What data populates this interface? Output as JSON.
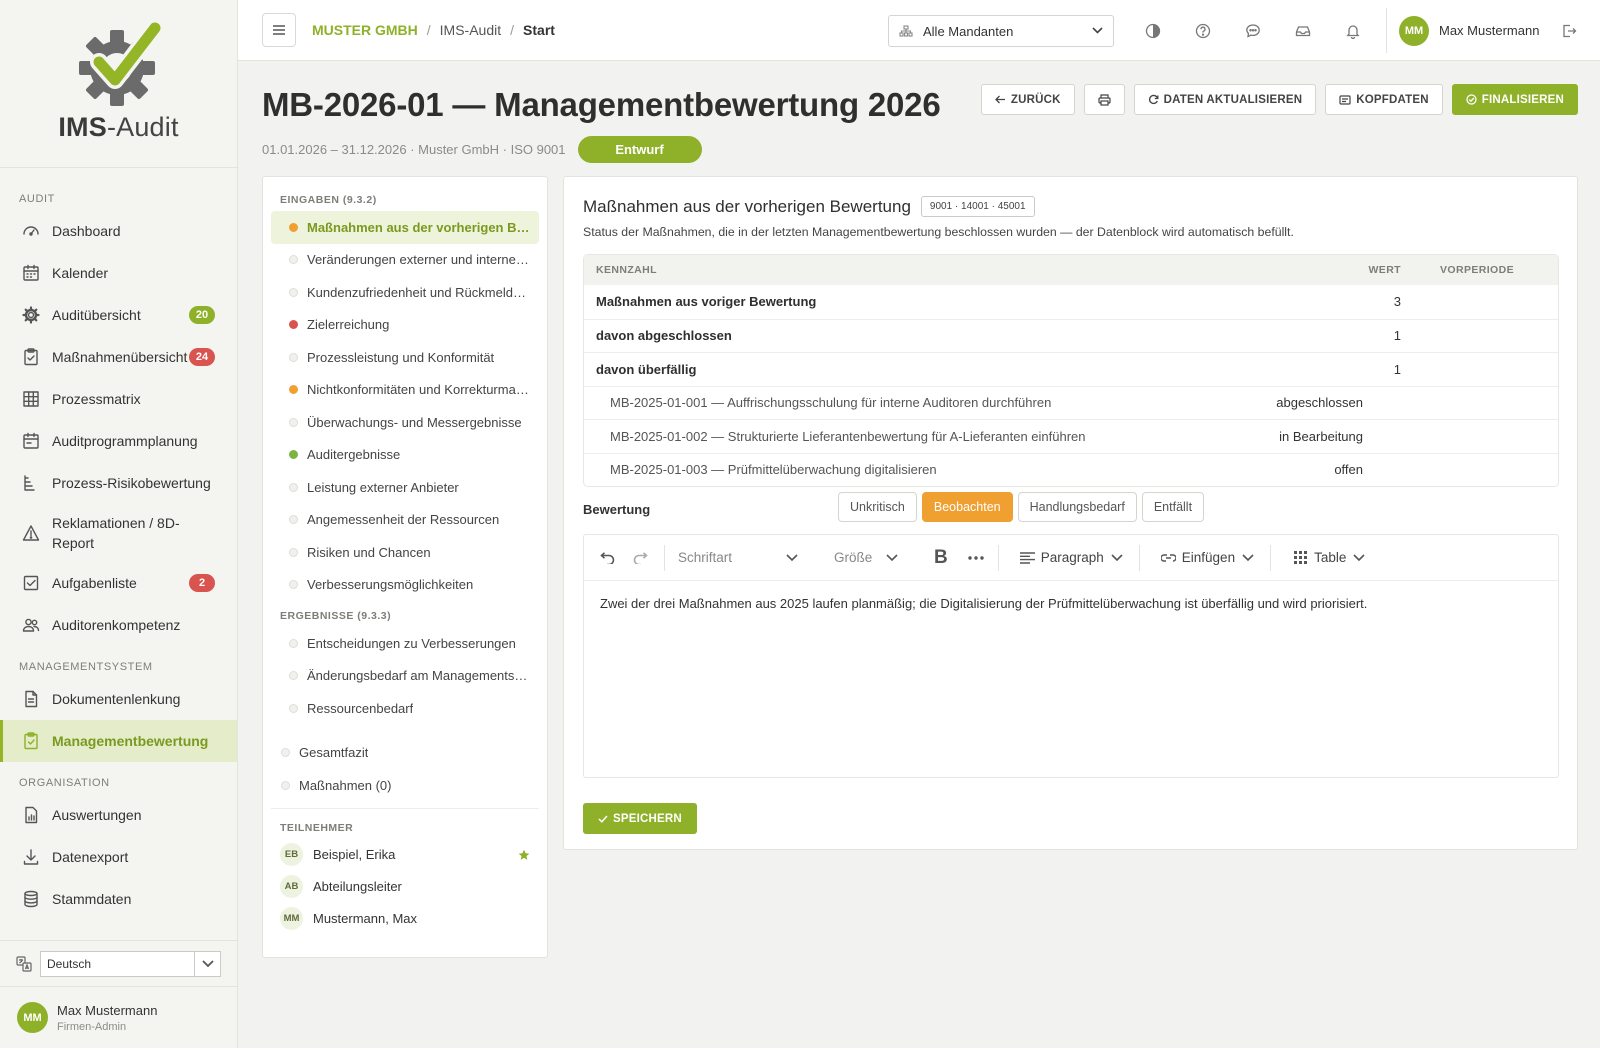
{
  "app": {
    "logo_bold": "IMS",
    "logo_rest": "-Audit"
  },
  "sidebar": {
    "sections": [
      {
        "label": "AUDIT",
        "items": [
          {
            "label": "Dashboard",
            "icon": "gauge-icon"
          },
          {
            "label": "Kalender",
            "icon": "calendar-icon"
          },
          {
            "label": "Auditübersicht",
            "icon": "gear-icon",
            "badge": "20",
            "badge_color": "#8fb12a"
          },
          {
            "label": "Maßnahmenübersicht",
            "icon": "clipboard-icon",
            "badge": "24",
            "badge_color": "#d9534f"
          },
          {
            "label": "Prozessmatrix",
            "icon": "grid-icon"
          },
          {
            "label": "Auditprogrammplanung",
            "icon": "calendar-plan-icon"
          },
          {
            "label": "Prozess-Risikobewertung",
            "icon": "list-tree-icon"
          },
          {
            "label": "Reklamationen / 8D-Report",
            "icon": "warning-icon"
          },
          {
            "label": "Aufgabenliste",
            "icon": "checkbox-icon",
            "badge": "2",
            "badge_color": "#d9534f"
          },
          {
            "label": "Auditorenkompetenz",
            "icon": "users-icon"
          }
        ]
      },
      {
        "label": "MANAGEMENTSYSTEM",
        "items": [
          {
            "label": "Dokumentenlenkung",
            "icon": "document-icon"
          },
          {
            "label": "Managementbewertung",
            "icon": "clipboard-check-icon",
            "active": true
          }
        ]
      },
      {
        "label": "ORGANISATION",
        "items": [
          {
            "label": "Auswertungen",
            "icon": "report-icon"
          },
          {
            "label": "Datenexport",
            "icon": "download-icon"
          },
          {
            "label": "Stammdaten",
            "icon": "database-icon"
          }
        ]
      }
    ],
    "language": "Deutsch",
    "user": {
      "initials": "MM",
      "name": "Max Mustermann",
      "role": "Firmen-Admin"
    }
  },
  "header": {
    "breadcrumb": [
      "MUSTER GMBH",
      "IMS-Audit",
      "Start"
    ],
    "mandant": "Alle Mandanten",
    "user_initials": "MM",
    "user_name": "Max Mustermann"
  },
  "page": {
    "title": "MB-2026-01 — Managementbewertung 2026",
    "meta": "01.01.2026 – 31.12.2026 · Muster GmbH · ISO 9001",
    "status": "Entwurf",
    "actions": {
      "back": "ZURÜCK",
      "refresh": "DATEN AKTUALISIEREN",
      "header": "KOPFDATEN",
      "finalize": "FINALISIEREN"
    }
  },
  "list": {
    "inputs_header": "EINGABEN (9.3.2)",
    "inputs": [
      {
        "label": "Maßnahmen aus der vorherigen Bew...",
        "dot": "#f0a030",
        "active": true
      },
      {
        "label": "Veränderungen externer und interner T...",
        "dot": ""
      },
      {
        "label": "Kundenzufriedenheit und Rückmeldun...",
        "dot": ""
      },
      {
        "label": "Zielerreichung",
        "dot": "#d9534f"
      },
      {
        "label": "Prozessleistung und Konformität",
        "dot": ""
      },
      {
        "label": "Nichtkonformitäten und Korrekturmaß...",
        "dot": "#f0a030"
      },
      {
        "label": "Überwachungs- und Messergebnisse",
        "dot": ""
      },
      {
        "label": "Auditergebnisse",
        "dot": "#7cb342"
      },
      {
        "label": "Leistung externer Anbieter",
        "dot": ""
      },
      {
        "label": "Angemessenheit der Ressourcen",
        "dot": ""
      },
      {
        "label": "Risiken und Chancen",
        "dot": ""
      },
      {
        "label": "Verbesserungsmöglichkeiten",
        "dot": ""
      }
    ],
    "results_header": "ERGEBNISSE (9.3.3)",
    "results": [
      {
        "label": "Entscheidungen zu Verbesserungen"
      },
      {
        "label": "Änderungsbedarf am Managementsyst..."
      },
      {
        "label": "Ressourcenbedarf"
      }
    ],
    "extra": [
      {
        "label": "Gesamtfazit"
      },
      {
        "label": "Maßnahmen (0)"
      }
    ],
    "participants_header": "TEILNEHMER",
    "participants": [
      {
        "initials": "EB",
        "name": "Beispiel, Erika",
        "star": true
      },
      {
        "initials": "AB",
        "name": "Abteilungsleiter"
      },
      {
        "initials": "MM",
        "name": "Mustermann, Max"
      }
    ]
  },
  "section": {
    "title": "Maßnahmen aus der vorherigen Bewertung",
    "tag": "9001 · 14001 · 45001",
    "description": "Status der Maßnahmen, die in der letzten Managementbewertung beschlossen wurden — der Datenblock wird automatisch befüllt.",
    "table": {
      "headers": [
        "KENNZAHL",
        "WERT",
        "VORPERIODE"
      ],
      "rows": [
        {
          "k": "Maßnahmen aus voriger Bewertung",
          "v": "3",
          "p": ""
        },
        {
          "k": "davon abgeschlossen",
          "v": "1",
          "p": ""
        },
        {
          "k": "davon überfällig",
          "v": "1",
          "p": ""
        }
      ],
      "subrows": [
        {
          "k": "MB-2025-01-001 — Auffrischungsschulung für interne Auditoren durchführen",
          "v": "abgeschlossen"
        },
        {
          "k": "MB-2025-01-002 — Strukturierte Lieferantenbewertung für A-Lieferanten einführen",
          "v": "in Bearbeitung"
        },
        {
          "k": "MB-2025-01-003 — Prüfmittelüberwachung digitalisieren",
          "v": "offen"
        }
      ]
    },
    "rating_label": "Bewertung",
    "ratings": [
      {
        "label": "Unkritisch"
      },
      {
        "label": "Beobachten",
        "selected": true
      },
      {
        "label": "Handlungsbedarf"
      },
      {
        "label": "Entfällt"
      }
    ],
    "editor": {
      "font": "Schriftart",
      "size": "Größe",
      "paragraph": "Paragraph",
      "insert": "Einfügen",
      "table": "Table",
      "content": "Zwei der drei Maßnahmen aus 2025 laufen planmäßig; die Digitalisierung der Prüfmittelüberwachung ist überfällig und wird priorisiert."
    },
    "save": "SPEICHERN"
  },
  "colors": {
    "accent": "#8fb12a",
    "warning": "#f0a030",
    "danger": "#d9534f",
    "success": "#7cb342"
  }
}
